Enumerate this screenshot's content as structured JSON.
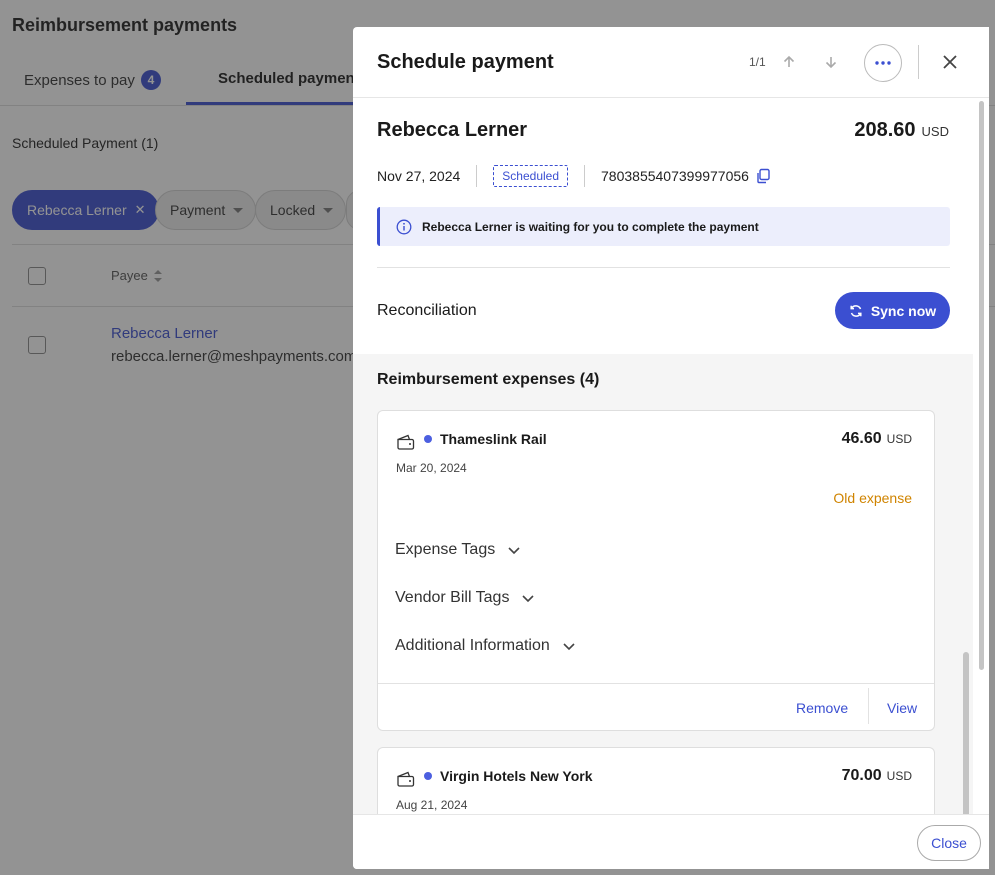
{
  "page": {
    "title": "Reimbursement payments",
    "tabs": [
      {
        "label": "Expenses to pay",
        "count": "4"
      },
      {
        "label": "Scheduled payments"
      }
    ],
    "section_title": "Scheduled Payment (1)",
    "filters": [
      {
        "label": "Rebecca Lerner",
        "active": true
      },
      {
        "label": "Payment"
      },
      {
        "label": "Locked"
      }
    ],
    "table": {
      "columns": [
        "Payee"
      ],
      "rows": [
        {
          "name": "Rebecca Lerner",
          "email": "rebecca.lerner@meshpayments.com"
        }
      ]
    }
  },
  "drawer": {
    "title": "Schedule payment",
    "pager": "1/1",
    "payee": "Rebecca Lerner",
    "amount": "208.60",
    "currency": "USD",
    "date": "Nov 27, 2024",
    "status": "Scheduled",
    "payment_id": "7803855407399977056",
    "info_message": "Rebecca Lerner is waiting for you to complete the payment",
    "reconciliation_label": "Reconciliation",
    "sync_label": "Sync now",
    "expenses_title": "Reimbursement expenses (4)",
    "expenses": [
      {
        "vendor": "Thameslink Rail",
        "amount": "46.60",
        "currency": "USD",
        "date": "Mar 20, 2024",
        "flag": "Old expense",
        "sections": [
          "Expense Tags",
          "Vendor Bill Tags",
          "Additional Information"
        ],
        "remove_label": "Remove",
        "view_label": "View"
      },
      {
        "vendor": "Virgin Hotels New York",
        "amount": "70.00",
        "currency": "USD",
        "date": "Aug 21, 2024"
      }
    ],
    "close_label": "Close"
  },
  "colors": {
    "accent": "#3b4fd1",
    "warning": "#d08400",
    "info_bg": "#eceefc"
  }
}
